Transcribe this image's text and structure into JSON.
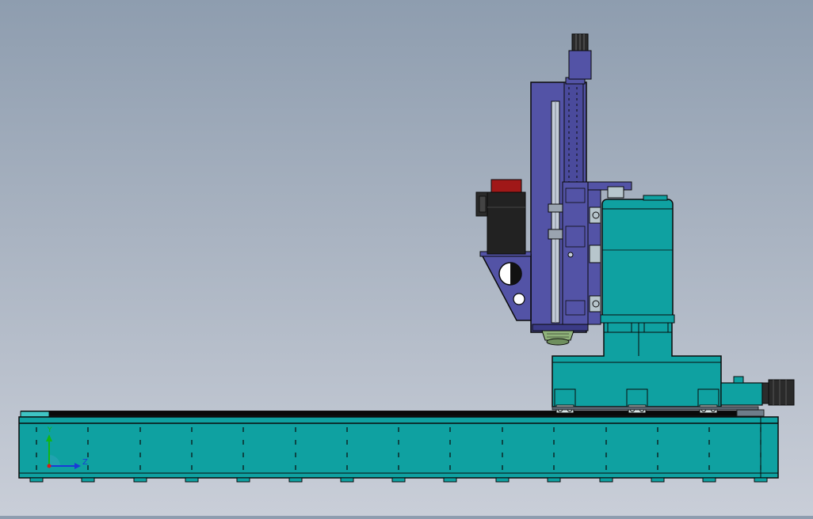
{
  "triad": {
    "y_label": "Y",
    "z_label": "Z"
  },
  "colors": {
    "teal": "#0fa1a1",
    "teal_dark": "#087a7a",
    "purple": "#5353a6",
    "purple_dark": "#3b3b86",
    "motor_black": "#222222",
    "motor_red": "#a01818",
    "spindle_green": "#8fb27a",
    "background_top": "#8e9daf",
    "background_bottom": "#c9ced8"
  },
  "icons": {
    "triad": "coordinate-triad-icon"
  }
}
